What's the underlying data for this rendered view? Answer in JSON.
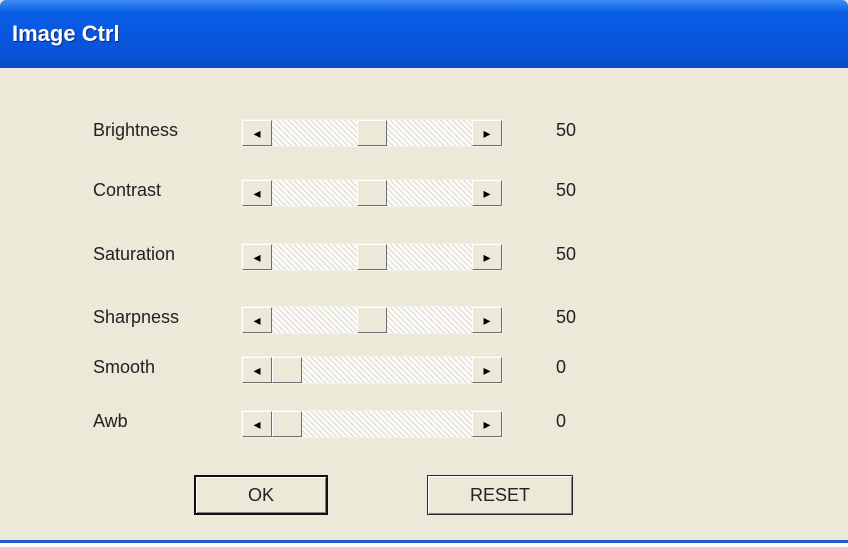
{
  "window": {
    "title": "Image Ctrl"
  },
  "sliders": [
    {
      "label": "Brightness",
      "value": "50",
      "position": 0.5
    },
    {
      "label": "Contrast",
      "value": "50",
      "position": 0.5
    },
    {
      "label": "Saturation",
      "value": "50",
      "position": 0.5
    },
    {
      "label": "Sharpness",
      "value": "50",
      "position": 0.5
    },
    {
      "label": "Smooth",
      "value": "0",
      "position": 0
    },
    {
      "label": "Awb",
      "value": "0",
      "position": 0
    }
  ],
  "arrows": {
    "left": "◂",
    "right": "▸"
  },
  "buttons": {
    "ok": "OK",
    "reset": "RESET"
  }
}
